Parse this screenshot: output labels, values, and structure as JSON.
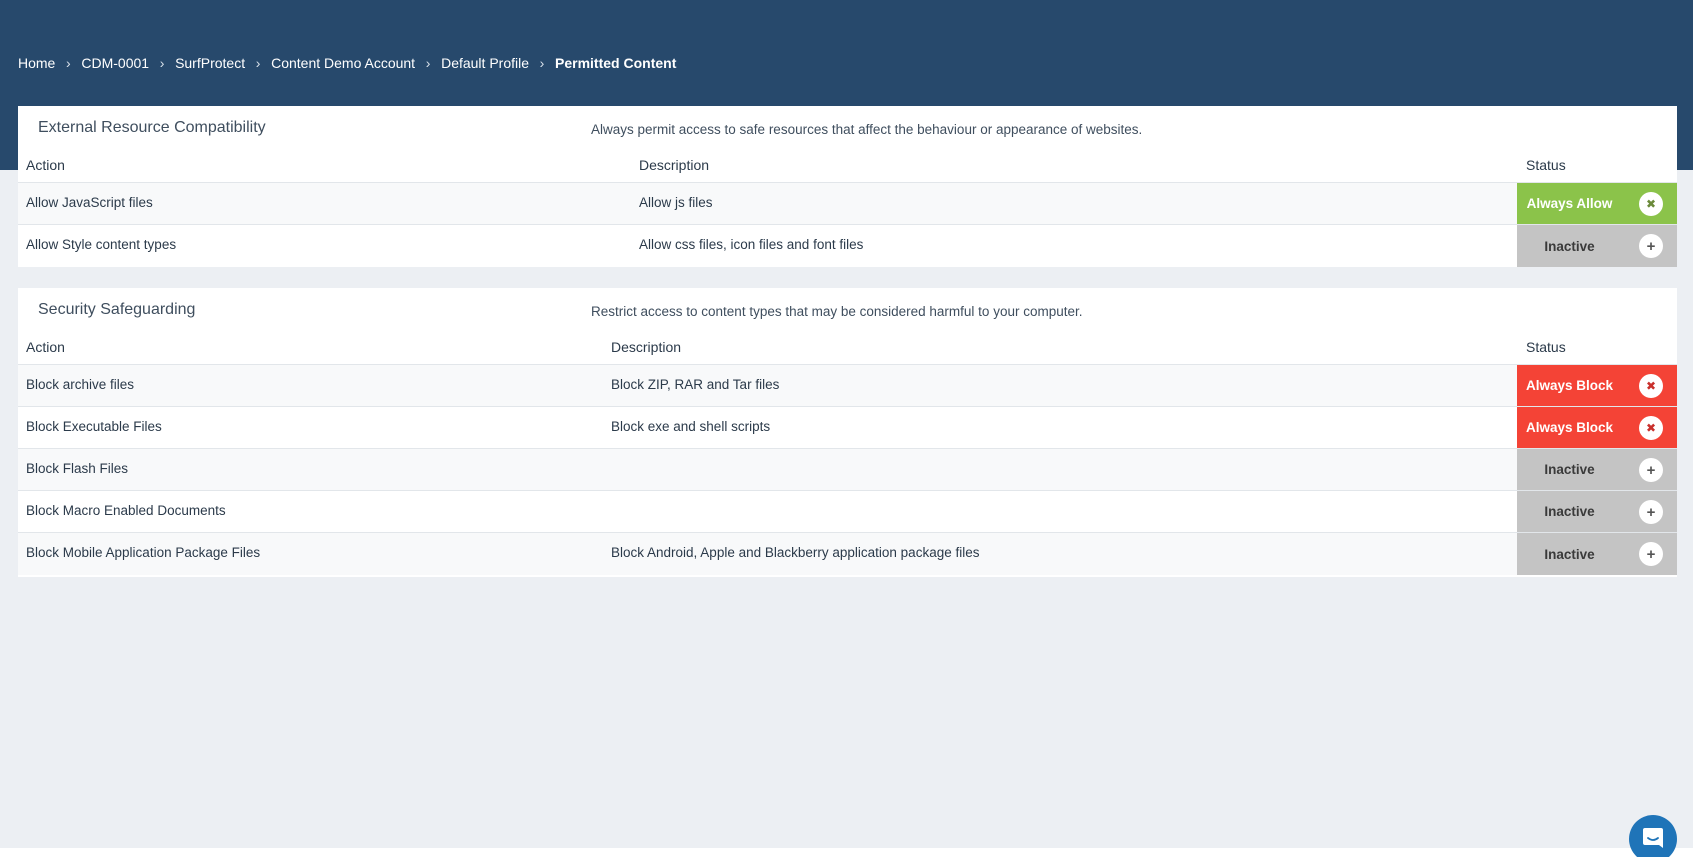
{
  "breadcrumb": {
    "items": [
      "Home",
      "CDM-0001",
      "SurfProtect",
      "Content Demo Account",
      "Default Profile"
    ],
    "current": "Permitted Content"
  },
  "panels": [
    {
      "title": "External Resource Compatibility",
      "description": "Always permit access to safe resources that affect the behaviour or appearance of websites.",
      "columns": {
        "action": "Action",
        "description": "Description",
        "status": "Status"
      },
      "rows": [
        {
          "action": "Allow JavaScript files",
          "description": "Allow js files",
          "status": "Always Allow",
          "state": "allow",
          "button_icon": "close-icon"
        },
        {
          "action": "Allow Style content types",
          "description": "Allow css files, icon files and font files",
          "status": "Inactive",
          "state": "inactive",
          "button_icon": "plus-icon"
        }
      ]
    },
    {
      "title": "Security Safeguarding",
      "description": "Restrict access to content types that may be considered harmful to your computer.",
      "columns": {
        "action": "Action",
        "description": "Description",
        "status": "Status"
      },
      "rows": [
        {
          "action": "Block archive files",
          "description": "Block ZIP, RAR and Tar files",
          "status": "Always Block",
          "state": "block",
          "button_icon": "close-icon"
        },
        {
          "action": "Block Executable Files",
          "description": "Block exe and shell scripts",
          "status": "Always Block",
          "state": "block",
          "button_icon": "close-icon"
        },
        {
          "action": "Block Flash Files",
          "description": "",
          "status": "Inactive",
          "state": "inactive",
          "button_icon": "plus-icon"
        },
        {
          "action": "Block Macro Enabled Documents",
          "description": "",
          "status": "Inactive",
          "state": "inactive",
          "button_icon": "plus-icon"
        },
        {
          "action": "Block Mobile Application Package Files",
          "description": "Block Android, Apple and Blackberry application package files",
          "status": "Inactive",
          "state": "inactive",
          "button_icon": "plus-icon"
        }
      ]
    }
  ],
  "colors": {
    "header_bg": "#27496c",
    "allow": "#8bc34a",
    "block": "#f44336",
    "inactive": "#c4c4c4",
    "chat": "#1f74b8"
  },
  "chat_icon": "chat-bubble-icon"
}
